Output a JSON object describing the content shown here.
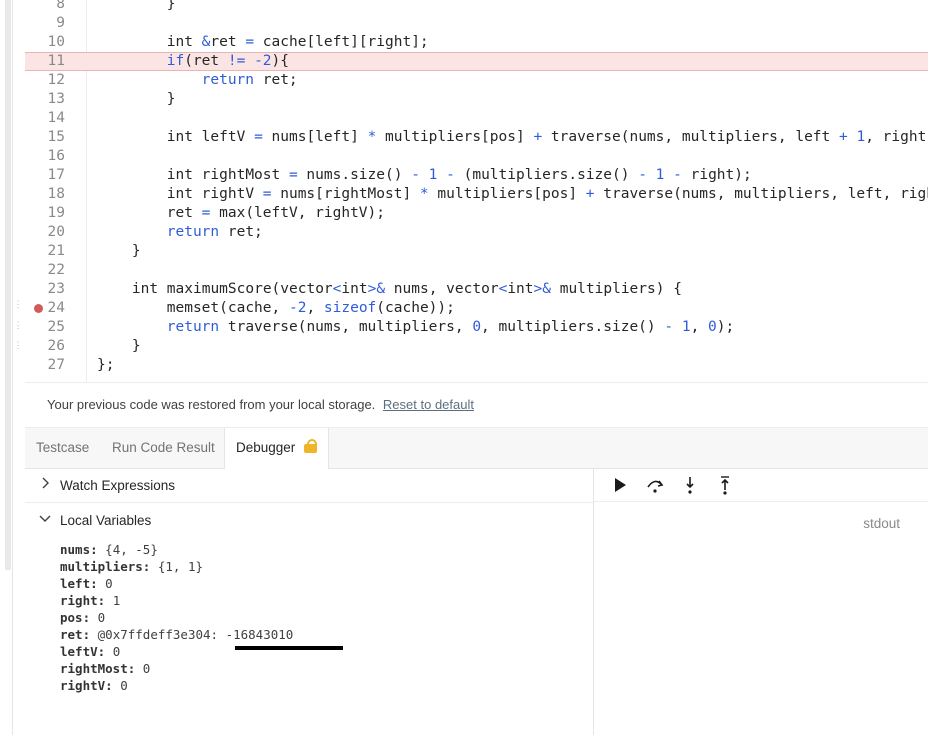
{
  "editor": {
    "lines": [
      {
        "n": "8",
        "tokens": [
          {
            "t": "}",
            "c": "id"
          }
        ],
        "indent": 8
      },
      {
        "n": "9",
        "tokens": [],
        "indent": 0
      },
      {
        "n": "10",
        "tokens": [
          {
            "t": "int ",
            "c": "id"
          },
          {
            "t": "&",
            "c": "op"
          },
          {
            "t": "ret ",
            "c": "id"
          },
          {
            "t": "=",
            "c": "op"
          },
          {
            "t": " cache[left][right];",
            "c": "id"
          }
        ],
        "indent": 8
      },
      {
        "n": "11",
        "tokens": [
          {
            "t": "if",
            "c": "kw"
          },
          {
            "t": "(ret ",
            "c": "id"
          },
          {
            "t": "!=",
            "c": "op"
          },
          {
            "t": " ",
            "c": "id"
          },
          {
            "t": "-2",
            "c": "num"
          },
          {
            "t": "){",
            "c": "id"
          }
        ],
        "indent": 8,
        "highlight": true
      },
      {
        "n": "12",
        "tokens": [
          {
            "t": "return",
            "c": "kw"
          },
          {
            "t": " ret;",
            "c": "id"
          }
        ],
        "indent": 12
      },
      {
        "n": "13",
        "tokens": [
          {
            "t": "}",
            "c": "id"
          }
        ],
        "indent": 8
      },
      {
        "n": "14",
        "tokens": [],
        "indent": 0
      },
      {
        "n": "15",
        "tokens": [
          {
            "t": "int leftV ",
            "c": "id"
          },
          {
            "t": "=",
            "c": "op"
          },
          {
            "t": " nums[left] ",
            "c": "id"
          },
          {
            "t": "*",
            "c": "op"
          },
          {
            "t": " multipliers[pos] ",
            "c": "id"
          },
          {
            "t": "+",
            "c": "op"
          },
          {
            "t": " traverse(nums, multipliers, left ",
            "c": "id"
          },
          {
            "t": "+",
            "c": "op"
          },
          {
            "t": " ",
            "c": "id"
          },
          {
            "t": "1",
            "c": "num"
          },
          {
            "t": ", right, pos",
            "c": "id"
          }
        ],
        "indent": 8
      },
      {
        "n": "16",
        "tokens": [],
        "indent": 0
      },
      {
        "n": "17",
        "tokens": [
          {
            "t": "int rightMost ",
            "c": "id"
          },
          {
            "t": "=",
            "c": "op"
          },
          {
            "t": " nums.size() ",
            "c": "id"
          },
          {
            "t": "-",
            "c": "op"
          },
          {
            "t": " ",
            "c": "id"
          },
          {
            "t": "1",
            "c": "num"
          },
          {
            "t": " ",
            "c": "id"
          },
          {
            "t": "-",
            "c": "op"
          },
          {
            "t": " (multipliers.size() ",
            "c": "id"
          },
          {
            "t": "-",
            "c": "op"
          },
          {
            "t": " ",
            "c": "id"
          },
          {
            "t": "1",
            "c": "num"
          },
          {
            "t": " ",
            "c": "id"
          },
          {
            "t": "-",
            "c": "op"
          },
          {
            "t": " right);",
            "c": "id"
          }
        ],
        "indent": 8
      },
      {
        "n": "18",
        "tokens": [
          {
            "t": "int rightV ",
            "c": "id"
          },
          {
            "t": "=",
            "c": "op"
          },
          {
            "t": " nums[rightMost] ",
            "c": "id"
          },
          {
            "t": "*",
            "c": "op"
          },
          {
            "t": " multipliers[pos] ",
            "c": "id"
          },
          {
            "t": "+",
            "c": "op"
          },
          {
            "t": " traverse(nums, multipliers, left, right",
            "c": "id"
          }
        ],
        "indent": 8
      },
      {
        "n": "19",
        "tokens": [
          {
            "t": "ret ",
            "c": "id"
          },
          {
            "t": "=",
            "c": "op"
          },
          {
            "t": " max(leftV, rightV);",
            "c": "id"
          }
        ],
        "indent": 8
      },
      {
        "n": "20",
        "tokens": [
          {
            "t": "return",
            "c": "kw"
          },
          {
            "t": " ret;",
            "c": "id"
          }
        ],
        "indent": 8
      },
      {
        "n": "21",
        "tokens": [
          {
            "t": "}",
            "c": "id"
          }
        ],
        "indent": 4
      },
      {
        "n": "22",
        "tokens": [],
        "indent": 0
      },
      {
        "n": "23",
        "tokens": [
          {
            "t": "int maximumScore(vector",
            "c": "id"
          },
          {
            "t": "<",
            "c": "op"
          },
          {
            "t": "int",
            "c": "id"
          },
          {
            "t": ">&",
            "c": "op"
          },
          {
            "t": " nums, vector",
            "c": "id"
          },
          {
            "t": "<",
            "c": "op"
          },
          {
            "t": "int",
            "c": "id"
          },
          {
            "t": ">&",
            "c": "op"
          },
          {
            "t": " multipliers) {",
            "c": "id"
          }
        ],
        "indent": 4
      },
      {
        "n": "24",
        "tokens": [
          {
            "t": "memset(cache, ",
            "c": "id"
          },
          {
            "t": "-2",
            "c": "num"
          },
          {
            "t": ", ",
            "c": "id"
          },
          {
            "t": "sizeof",
            "c": "kw"
          },
          {
            "t": "(cache));",
            "c": "id"
          }
        ],
        "indent": 8,
        "breakpoint": true
      },
      {
        "n": "25",
        "tokens": [
          {
            "t": "return",
            "c": "kw"
          },
          {
            "t": " traverse(nums, multipliers, ",
            "c": "id"
          },
          {
            "t": "0",
            "c": "num"
          },
          {
            "t": ", multipliers.size() ",
            "c": "id"
          },
          {
            "t": "-",
            "c": "op"
          },
          {
            "t": " ",
            "c": "id"
          },
          {
            "t": "1",
            "c": "num"
          },
          {
            "t": ", ",
            "c": "id"
          },
          {
            "t": "0",
            "c": "num"
          },
          {
            "t": ");",
            "c": "id"
          }
        ],
        "indent": 8
      },
      {
        "n": "26",
        "tokens": [
          {
            "t": "}",
            "c": "id"
          }
        ],
        "indent": 4
      },
      {
        "n": "27",
        "tokens": [
          {
            "t": "};",
            "c": "id"
          }
        ],
        "indent": 0
      }
    ]
  },
  "notice": {
    "text": "Your previous code was restored from your local storage.",
    "reset_label": "Reset to default"
  },
  "tabs": {
    "testcase": "Testcase",
    "run_result": "Run Code Result",
    "debugger": "Debugger"
  },
  "debugger": {
    "watch_label": "Watch Expressions",
    "locals_label": "Local Variables",
    "variables": [
      {
        "name": "nums",
        "value": "{4, -5}"
      },
      {
        "name": "multipliers",
        "value": "{1, 1}"
      },
      {
        "name": "left",
        "value": "0"
      },
      {
        "name": "right",
        "value": "1"
      },
      {
        "name": "pos",
        "value": "0"
      },
      {
        "name": "ret",
        "value": "@0x7ffdeff3e304: -16843010"
      },
      {
        "name": "leftV",
        "value": "0"
      },
      {
        "name": "rightMost",
        "value": "0"
      },
      {
        "name": "rightV",
        "value": "0"
      }
    ],
    "stdout_label": "stdout",
    "controls": [
      "play-icon",
      "step-over-icon",
      "step-into-icon",
      "step-out-icon"
    ]
  },
  "colors": {
    "keyword": "#2f5cd8",
    "highlight_bg": "#fbe4e4",
    "breakpoint": "#d15b5b",
    "lock": "#f0b429"
  }
}
